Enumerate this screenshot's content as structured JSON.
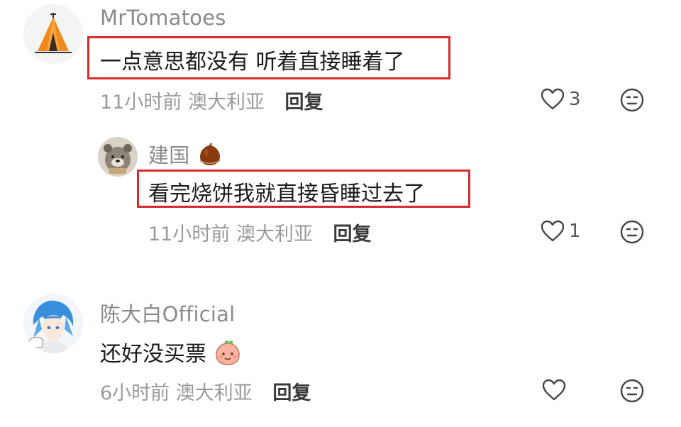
{
  "comments": [
    {
      "username": "MrTomatoes",
      "text": "一点意思都没有 听着直接睡着了",
      "time": "11小时前",
      "location": "澳大利亚",
      "reply_label": "回复",
      "likes": "3",
      "highlighted": true
    },
    {
      "username": "陈大白Official",
      "text": "还好没买票",
      "time": "6小时前",
      "location": "澳大利亚",
      "reply_label": "回复",
      "likes": "",
      "highlighted": false
    }
  ],
  "replies": [
    {
      "username": "建国",
      "text": "看完烧饼我就直接昏睡过去了",
      "time": "11小时前",
      "location": "澳大利亚",
      "reply_label": "回复",
      "likes": "1",
      "highlighted": true
    }
  ],
  "colors": {
    "highlight": "#d82a2a",
    "username": "#8a8a8a",
    "meta": "#9a9a9a"
  },
  "icons": {
    "like": "heart-outline-icon",
    "dislike": "neutral-face-icon"
  }
}
